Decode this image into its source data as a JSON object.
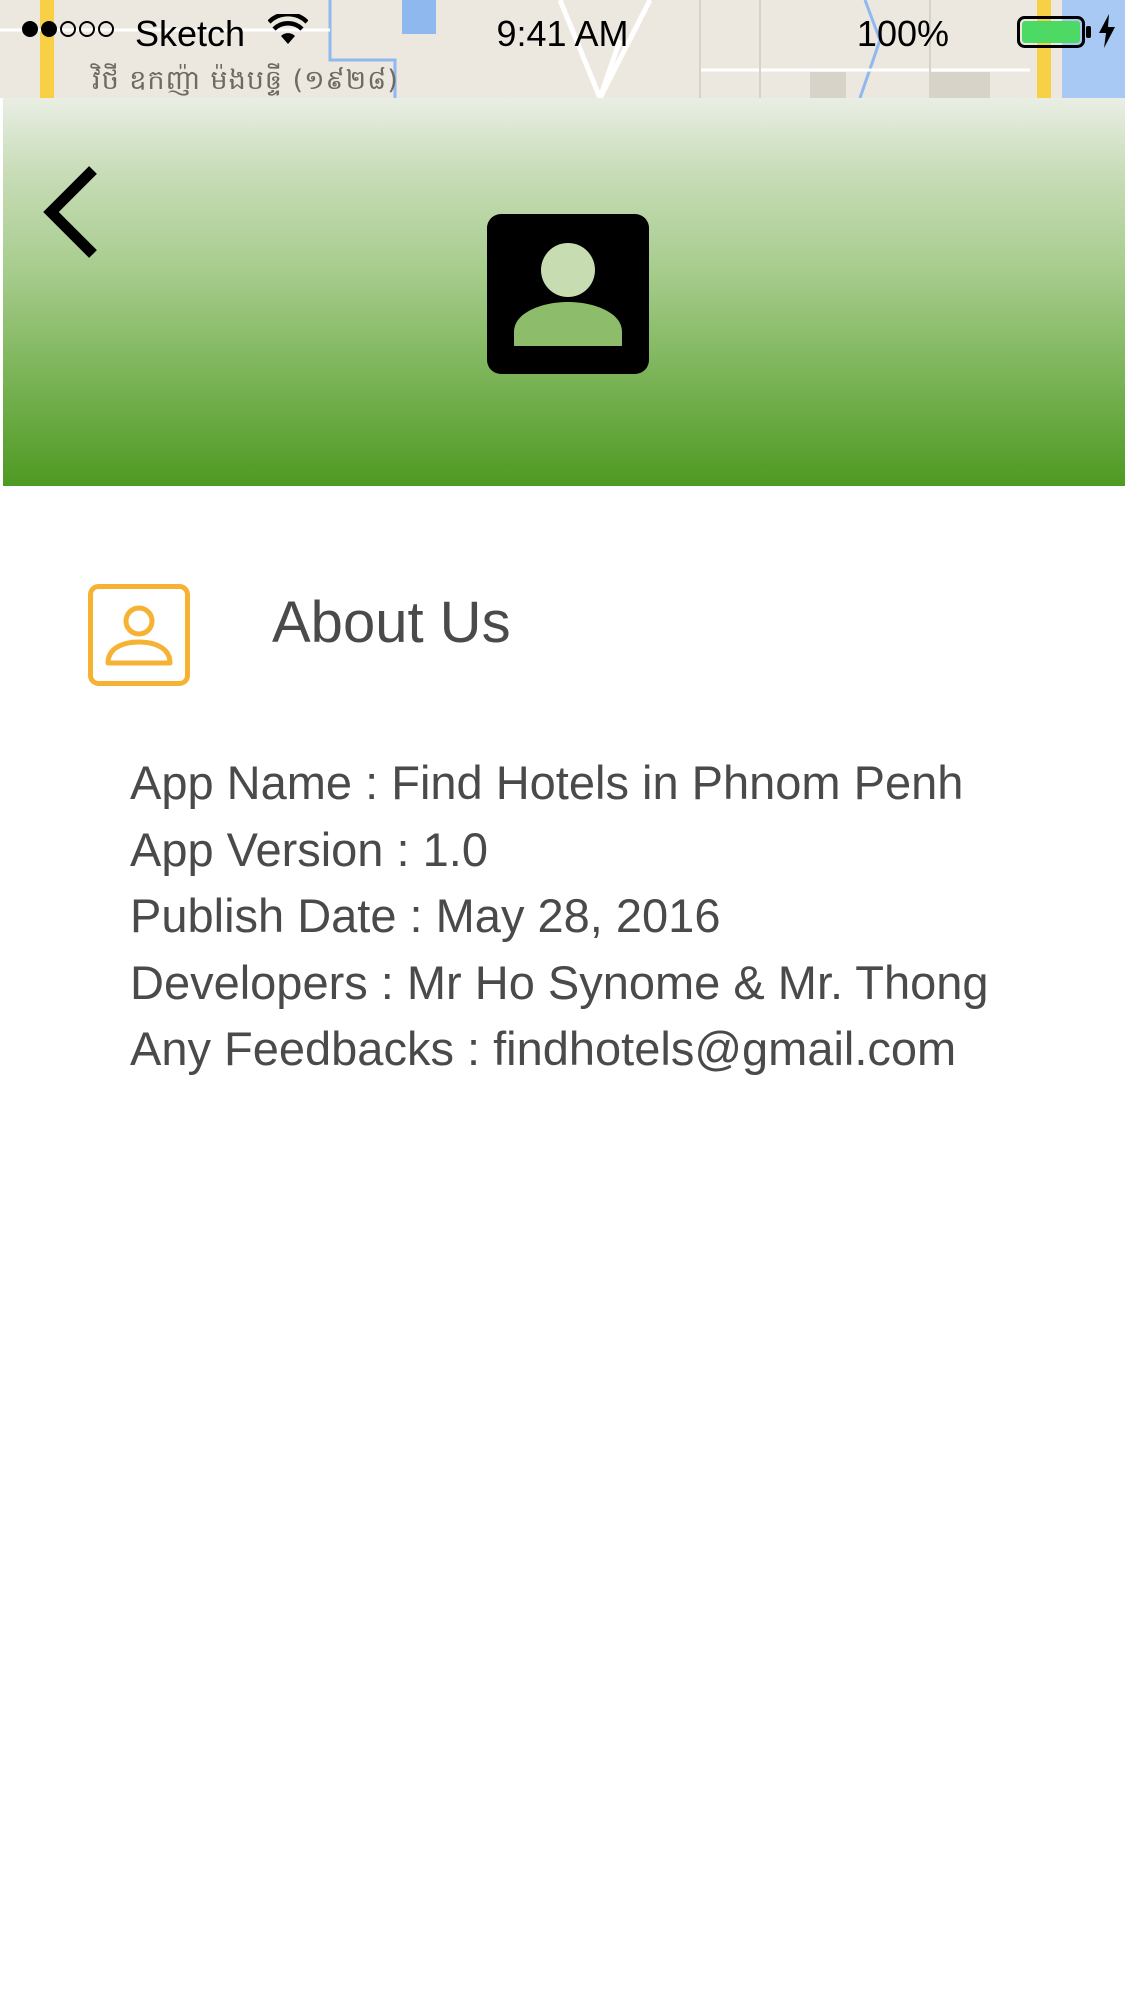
{
  "status_bar": {
    "carrier": "Sketch",
    "time": "9:41 AM",
    "battery_percent": "100%",
    "signal_filled": 2,
    "signal_total": 5,
    "icons": [
      "wifi-icon",
      "battery-icon",
      "charging-bolt-icon"
    ]
  },
  "map_background": {
    "label": "វិថី ឧកញ៉ា ម៉ងបឲ្ទី (១៩២៨)"
  },
  "header": {
    "back_icon": "chevron-left-icon",
    "avatar_icon": "contact-card-icon"
  },
  "about": {
    "icon": "contact-card-outline-icon",
    "title": "About Us",
    "lines": [
      "App Name : Find Hotels in Phnom Penh",
      "App Version : 1.0",
      "Publish Date : May 28, 2016",
      "Developers : Mr Ho Synome & Mr. Thong",
      "Any Feedbacks : findhotels@gmail.com"
    ]
  },
  "colors": {
    "header_gradient_top": "#e9eee4",
    "header_gradient_bottom": "#4e9a22",
    "accent_orange": "#f5b233",
    "text": "#4a4a4a",
    "battery_green": "#4cd964"
  }
}
